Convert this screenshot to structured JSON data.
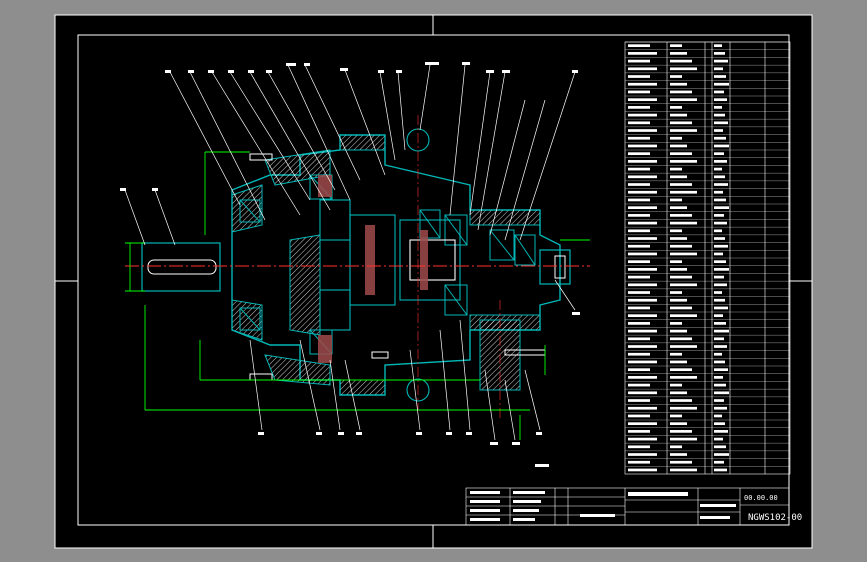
{
  "drawing": {
    "drawing_number": "NGWS102-00",
    "scale_hint": "00.00.00"
  },
  "colors": {
    "background": "#8e8e8e",
    "sheet": "#000000",
    "frame": "#ffffff",
    "body": "#00b7b7",
    "dimension": "#00ff00",
    "centerline": "#ff3030",
    "leader": "#ffffff",
    "hatch": "#a04a4a"
  },
  "icons": [
    "center-mark-icon"
  ]
}
